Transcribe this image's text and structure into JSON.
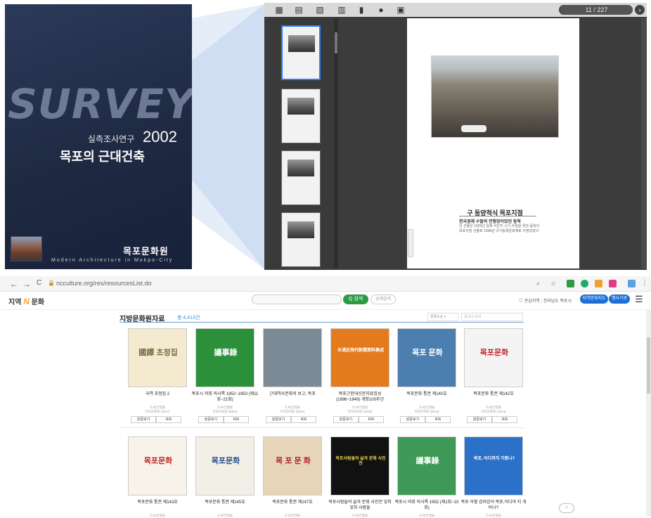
{
  "cover": {
    "survey": "SURVEY",
    "subtitle": "실측조사연구",
    "year": "2002",
    "title": "목포의 근대건축",
    "publisher": "목포문화원",
    "english": "Modern Architecture in Mokpo-City"
  },
  "viewer": {
    "page_counter": "11 / 227",
    "prev_icon": "chevron-left-icon",
    "next_icon": "chevron-right-icon",
    "toolbar_icons": [
      "grid-icon",
      "page-icon",
      "export-icon",
      "print-icon",
      "book-icon",
      "info-icon",
      "fit-icon"
    ],
    "caption_title": "구 동양척식 목포지점",
    "caption_sub": "한국경제 수탈의 전형장이었던 동척",
    "caption_body": "이 건물은 1920년 일제 식민지 시기 수탈을 위한 동척의 목포지점 건물로 1998년 국가등록문화재로 지정되었다"
  },
  "browser": {
    "back": "←",
    "forward": "→",
    "reload": "C",
    "url": "ncculture.org/res/resourcesList.do",
    "colors": {
      "accent_green": "#2e9b43",
      "accent_blue": "#1d6fd6"
    }
  },
  "site": {
    "logo_prefix": "지역",
    "logo_mark": "N",
    "logo_suffix": "문화",
    "search_button": "Q 검색",
    "detail_button": "상세검색",
    "location": "♡ 관심지역 : 전라남도 목포시",
    "btn_local": "지역문화지도",
    "btn_event": "행사기로"
  },
  "content": {
    "heading": "지방문화원자료",
    "count": "총 4,413건",
    "sort": "정확도순 ▾",
    "in_results": "결과내 검색",
    "view_btn": "원문보기",
    "ris_btn": "RIS",
    "cards": [
      {
        "title": "국역 초정집 2",
        "m1": "도서/간행물",
        "m2": "목포문화원 (2017)",
        "cover_text": "國譯 초정집",
        "bg": "#f3ead0",
        "fg": "#7a6a40"
      },
      {
        "title": "목포시 의회 의사록 1952~1953 (제11회~21회)",
        "m1": "도서/간행물",
        "m2": "목포문화원 (2004)",
        "cover_text": "議事錄",
        "bg": "#2c8f3a",
        "fg": "#ffffff"
      },
      {
        "title": "근대역사문화의 보고, 목포",
        "m1": "도서/간행물",
        "m2": "목포문화원 (2011)",
        "cover_text": "",
        "bg": "#7b8a95",
        "fg": "#ffffff"
      },
      {
        "title": "목포근현대신문자료집성 (1896~1949) 개항100주년",
        "m1": "도서/간행물",
        "m2": "목포문화원 (2010)",
        "cover_text": "木浦近現代新聞資料集成",
        "bg": "#e47a1e",
        "fg": "#ffffff"
      },
      {
        "title": "목포문화 통권 제140호",
        "m1": "도서/간행물",
        "m2": "목포문화원 (2013)",
        "cover_text": "목포 문화",
        "bg": "#4c7fb0",
        "fg": "#ffffff"
      },
      {
        "title": "목포문화 통권 제142호",
        "m1": "도서/간행물",
        "m2": "목포문화원 (2014)",
        "cover_text": "목포문화",
        "bg": "#f4f4f4",
        "fg": "#c0282d"
      },
      {
        "title": "목포문화 통권 제143호",
        "m1": "도서/간행물",
        "m2": "",
        "cover_text": "목포문화",
        "bg": "#f7f2ea",
        "fg": "#c0282d"
      },
      {
        "title": "목포문화 통권 제145호",
        "m1": "도서/간행물",
        "m2": "",
        "cover_text": "목포문화",
        "bg": "#f2efe6",
        "fg": "#1f4d8c"
      },
      {
        "title": "목포문화 통권 제147호",
        "m1": "도서/간행물",
        "m2": "",
        "cover_text": "목 포 문 화",
        "bg": "#e7d5b8",
        "fg": "#b0262b"
      },
      {
        "title": "목포사람들의 삶과 문화 사진전 잊혀 잊혀 사람들",
        "m1": "도서/간행물",
        "m2": "",
        "cover_text": "목포사람들의 삶과 문화 사진전",
        "bg": "#111111",
        "fg": "#e7d44a"
      },
      {
        "title": "목포시 의회 의사록 1952 (제1회~10회)",
        "m1": "도서/간행물",
        "m2": "",
        "cover_text": "議事錄",
        "bg": "#3f9a58",
        "fg": "#ffffff"
      },
      {
        "title": "목포 어떻 감려갔어 목포,어디야 지 개비나?",
        "m1": "도서/간행물",
        "m2": "",
        "cover_text": "목포, 어디까지 가봤니?",
        "bg": "#2c71c9",
        "fg": "#ffffff"
      }
    ],
    "top_button": "↑"
  }
}
